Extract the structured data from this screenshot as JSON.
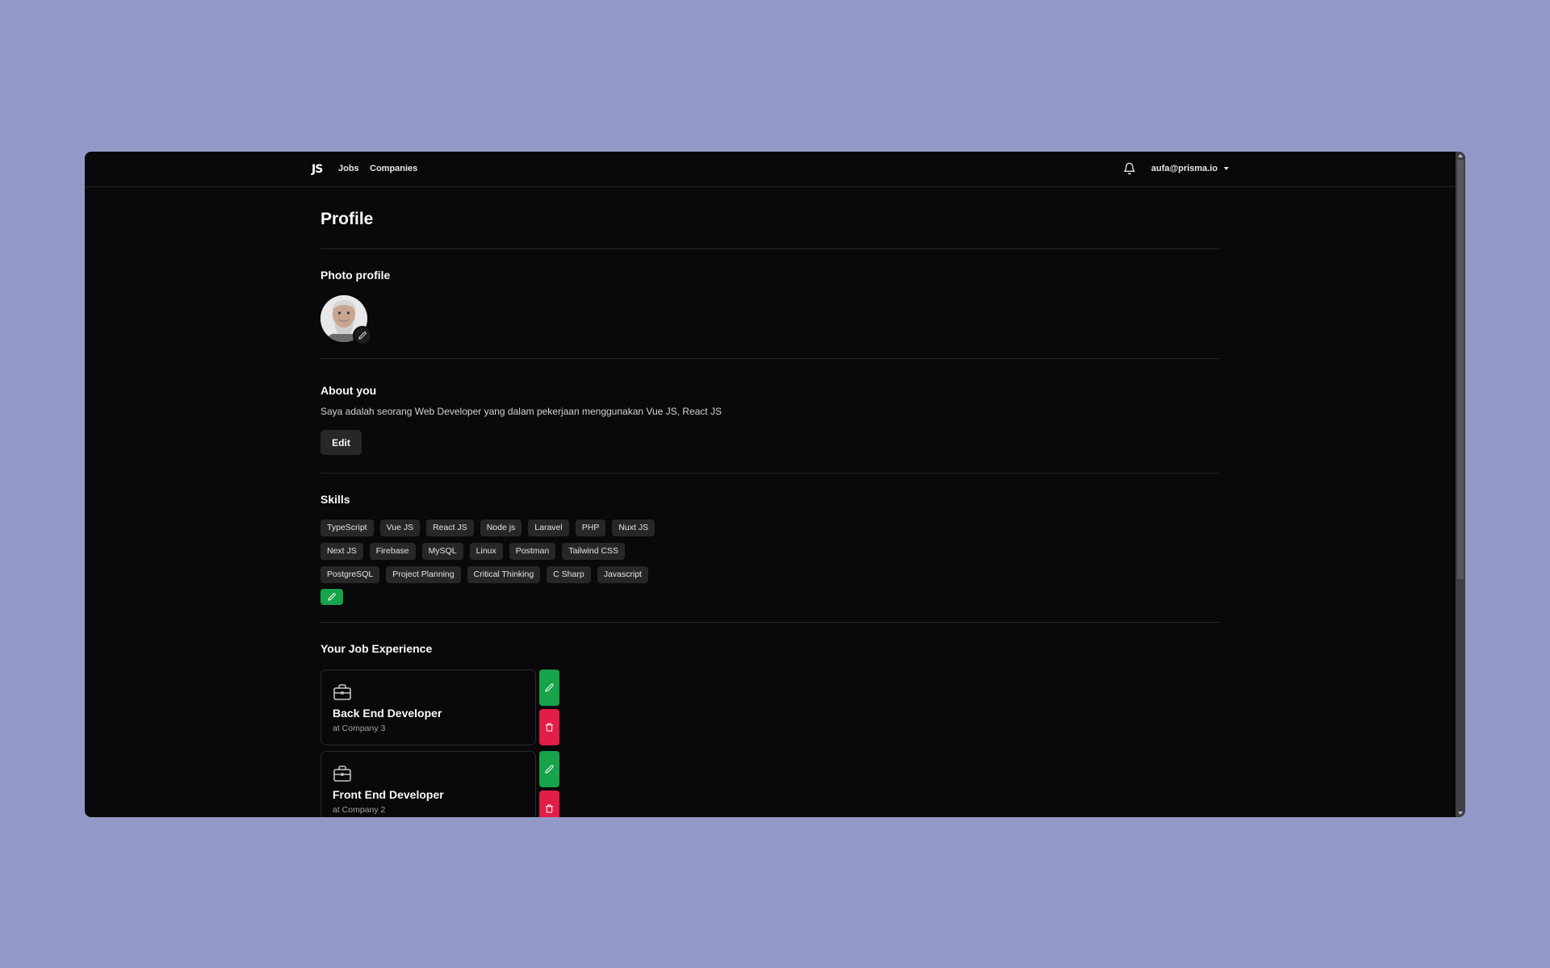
{
  "nav": {
    "logo": "JS",
    "links": [
      "Jobs",
      "Companies"
    ],
    "user_email": "aufa@prisma.io"
  },
  "page": {
    "title": "Profile"
  },
  "photo": {
    "heading": "Photo profile"
  },
  "about": {
    "heading": "About you",
    "text": "Saya adalah seorang Web Developer yang dalam pekerjaan menggunakan Vue JS, React JS",
    "edit_label": "Edit"
  },
  "skills": {
    "heading": "Skills",
    "rows": [
      [
        "TypeScript",
        "Vue JS",
        "React JS",
        "Node js",
        "Laravel",
        "PHP",
        "Nuxt JS"
      ],
      [
        "Next JS",
        "Firebase",
        "MySQL",
        "Linux",
        "Postman",
        "Tailwind CSS"
      ],
      [
        "PostgreSQL",
        "Project Planning",
        "Critical Thinking",
        "C Sharp",
        "Javascript"
      ]
    ]
  },
  "experience": {
    "heading": "Your Job Experience",
    "jobs": [
      {
        "title": "Back End Developer",
        "company": "at Company 3"
      },
      {
        "title": "Front End Developer",
        "company": "at Company 2"
      }
    ]
  },
  "colors": {
    "background": "#9299c6",
    "app_bg": "#09090b",
    "edit_green": "#16a34a",
    "delete_red": "#e11d48"
  }
}
